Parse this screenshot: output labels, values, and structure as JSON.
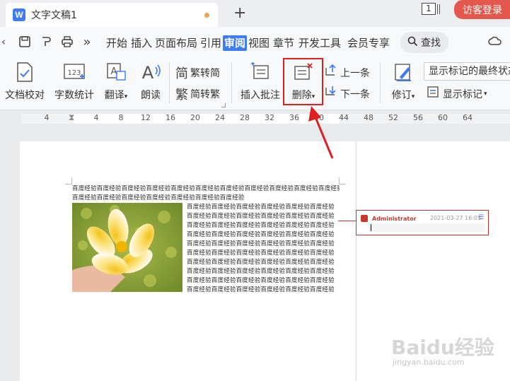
{
  "titlebar": {
    "app_icon_letter": "W",
    "doc_title": "文字文稿1",
    "new_tab": "+",
    "window_count": "1",
    "login_label": "访客登录"
  },
  "menubar": {
    "overflow": "»",
    "tabs": [
      "开始",
      "插入",
      "页面布局",
      "引用",
      "审阅",
      "视图",
      "章节",
      "开发工具",
      "会员专享"
    ],
    "active_tab": "审阅",
    "search_label": "查找"
  },
  "ribbon": {
    "doc_check": "文档校对",
    "word_count": "字数统计",
    "translate": "翻译",
    "read_aloud": "朗读",
    "trad_to_simp": "繁转简",
    "simp_to_trad": "简转繁",
    "insert_comment": "插入批注",
    "delete": "删除",
    "prev": "上一条",
    "next": "下一条",
    "track_changes": "修订",
    "show_markup": "显示标记",
    "show_final_dropdown": "显示标记的最终状态",
    "word_count_icon_text": "123"
  },
  "ruler": {
    "ticks": [
      "4",
      "4",
      "8",
      "12",
      "16",
      "20",
      "24",
      "28",
      "32",
      "36",
      "40",
      "44",
      "48",
      "52",
      "56",
      "60",
      "64"
    ]
  },
  "document": {
    "line1": "百度经验百度经验百度经验百度经验百度经验百度经验百度经验百度经验百度经验百度经验百度经验百度经验",
    "line2": "百度经验百度经验百度经验百度经验百度经验百度经验百度经验",
    "wrap_text": "百度经验百度经验百度经验百度经验百度经验百度经验百度经验百度经验百度经验百度经验百度经验百度经验百度经验百度经验百度经验百度经验百度经验百度经验百度经验百度经验百度经验百度经验百度经验百度经验百度经验百度经验百度经验百度经验百度经验百度经验百度经验百度经验百度经验百度经验百度经验百度经验百度经验百度经验百度经验百度经验百度经验百度经验百度经验百度经验百度经验百度经验百度经验百度经验百度经验百度经验百度经验百度经验百度经验百度经验百度经验百度经验百度经验百度经验百度经验百度经验百度经验百度经验百度经验百度经验百度经验百度经验"
  },
  "comment": {
    "author": "Administrator",
    "time": "2021-03-27 16:05"
  },
  "watermark": {
    "main": "Baidu经验",
    "sub": "jingyan.baidu.com"
  },
  "colors": {
    "accent": "#3d7cf5",
    "login": "#e4574c",
    "highlight_box": "#e02020",
    "comment": "#c0392b"
  }
}
